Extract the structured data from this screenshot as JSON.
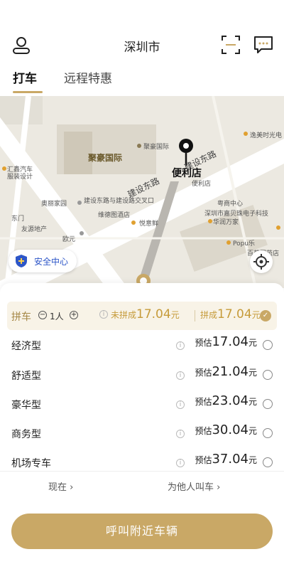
{
  "header": {
    "title": "深圳市"
  },
  "tabs": [
    {
      "label": "打车",
      "active": true
    },
    {
      "label": "远程特惠",
      "active": false
    }
  ],
  "map": {
    "road_label_1": "建设东路",
    "road_label_2": "建设东路",
    "building_label": "聚豪国际",
    "pin_label": "便利店",
    "poi": [
      "聚豪国际",
      "逸美时光电",
      "汇鑫汽车",
      "服装设计",
      "东门",
      "友源地产",
      "欧元",
      "奥丽家园",
      "建设东路与建设路交叉口",
      "维德图酒店",
      "悦意鲜",
      "便利店",
      "粤商中心",
      "深圳市嘉贝珠电子科技",
      "华润万家",
      "Popu乐",
      "百草园药店"
    ],
    "safety_center": "安全中心"
  },
  "carpool": {
    "label": "拼车",
    "count": "1人",
    "no_match_prefix": "未拼成",
    "no_match_price": "17.04",
    "no_match_unit": "元",
    "match_prefix": "拼成",
    "match_price": "17.04",
    "match_unit": "元",
    "checked": true
  },
  "car_types": [
    {
      "name": "经济型",
      "prefix": "预估",
      "price": "17.04",
      "unit": "元"
    },
    {
      "name": "舒适型",
      "prefix": "预估",
      "price": "21.04",
      "unit": "元"
    },
    {
      "name": "豪华型",
      "prefix": "预估",
      "price": "23.04",
      "unit": "元"
    },
    {
      "name": "商务型",
      "prefix": "预估",
      "price": "30.04",
      "unit": "元"
    },
    {
      "name": "机场专车",
      "prefix": "预估",
      "price": "37.04",
      "unit": "元"
    }
  ],
  "options": {
    "now": "现在 ›",
    "for_others": "为他人叫车 ›"
  },
  "call_button": "呼叫附近车辆",
  "colors": {
    "accent": "#c9a866",
    "price_gold": "#c69b3a",
    "safety_blue": "#2d56c8"
  }
}
